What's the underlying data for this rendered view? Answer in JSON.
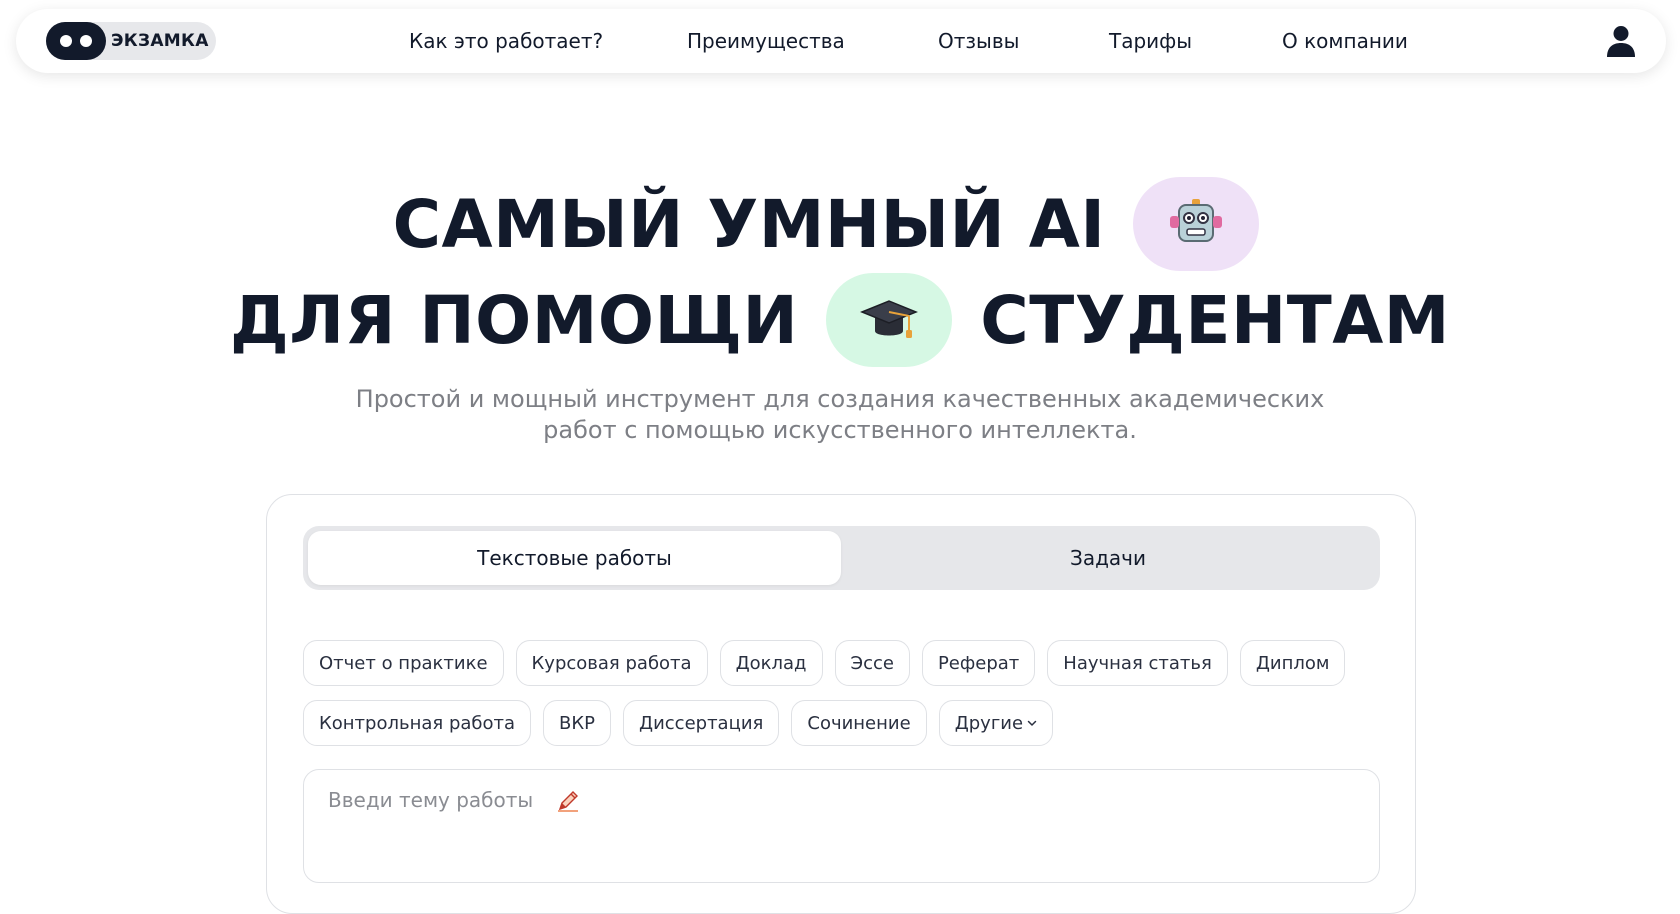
{
  "header": {
    "logo_text": "ЭКЗАМКА",
    "nav": [
      {
        "label": "Как это работает?"
      },
      {
        "label": "Преимущества"
      },
      {
        "label": "Отзывы"
      },
      {
        "label": "Тарифы"
      },
      {
        "label": "О компании"
      }
    ],
    "user_icon": "user-icon"
  },
  "hero": {
    "line1": "САМЫЙ УМНЫЙ AI",
    "line2_left": "ДЛЯ ПОМОЩИ",
    "line2_right": "СТУДЕНТАМ",
    "icons": [
      "robot-icon",
      "graduation-cap-icon"
    ],
    "subtitle_line1": "Простой и мощный инструмент для создания качественных академических",
    "subtitle_line2": "работ с помощью искусственного интеллекта."
  },
  "form": {
    "tabs": [
      {
        "label": "Текстовые работы",
        "active": true
      },
      {
        "label": "Задачи",
        "active": false
      }
    ],
    "work_types_row1": [
      "Отчет о практике",
      "Курсовая работа",
      "Доклад",
      "Эссе",
      "Реферат",
      "Научная статья",
      "Диплом"
    ],
    "work_types_row2": [
      "Контрольная работа",
      "ВКР",
      "Диссертация",
      "Сочинение"
    ],
    "more_label": "Другие",
    "topic_placeholder": "Введи тему работы",
    "topic_value": ""
  },
  "colors": {
    "text": "#121a2b",
    "subtitle": "#7d7f85",
    "robot_pill": "#efe1f7",
    "cap_pill": "#d6f8e4",
    "tabs_bg": "#e6e7ea"
  }
}
